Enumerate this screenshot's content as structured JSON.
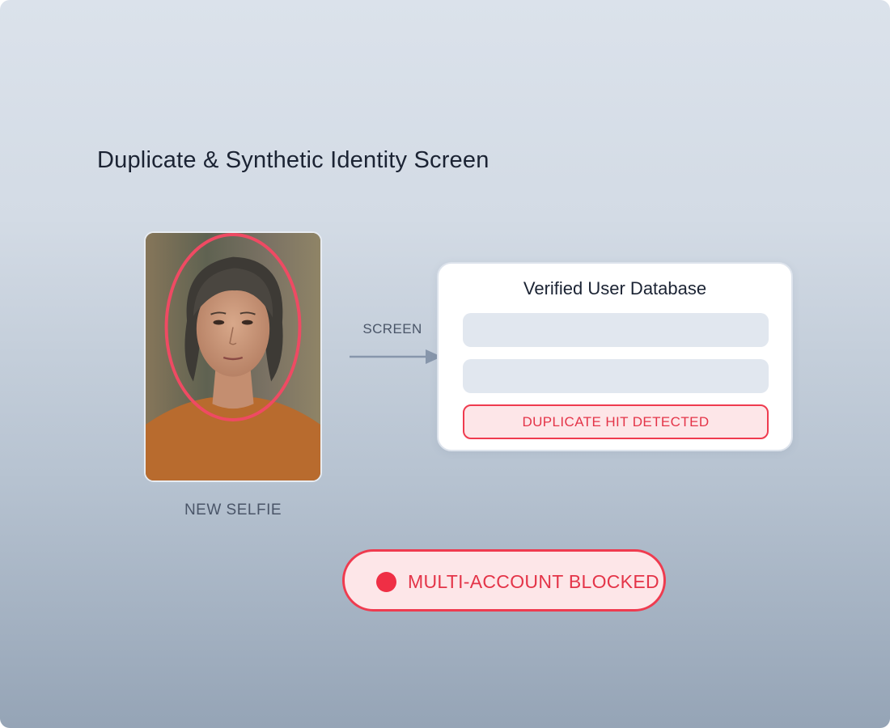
{
  "page": {
    "title": "Duplicate & Synthetic Identity Screen"
  },
  "selfie": {
    "caption": "NEW SELFIE",
    "highlight_color": "#ef4a63"
  },
  "flow": {
    "arrow_label": "SCREEN",
    "arrow_icon": "arrow-right-icon"
  },
  "database": {
    "title": "Verified User Database",
    "hit_label": "DUPLICATE HIT DETECTED"
  },
  "status": {
    "label": "MULTI-ACCOUNT BLOCKED",
    "indicator_color": "#ef2f45"
  },
  "colors": {
    "alert": "#ef3b4f",
    "alert_bg": "#fde6e8",
    "text_primary": "#1b2333",
    "text_muted": "#4a5568"
  }
}
